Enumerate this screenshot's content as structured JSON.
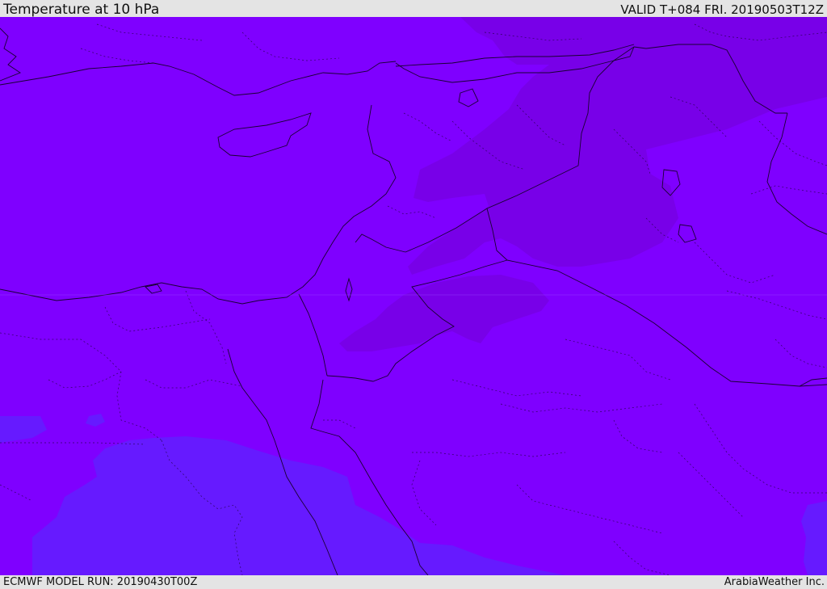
{
  "header": {
    "title": "Temperature at 10 hPa",
    "valid": "VALID T+084 FRI. 20190503T12Z"
  },
  "footer": {
    "model_run": "ECMWF MODEL RUN: 20190430T00Z",
    "credit": "ArabiaWeather Inc."
  },
  "map": {
    "field": "temperature",
    "level": "10 hPa",
    "colors": {
      "base_field": "#7f00ff",
      "warmer_zone": "#7800e8",
      "cooler_zone": "#661aff",
      "coastline": "#1a0033",
      "border": "#1a0033"
    }
  }
}
